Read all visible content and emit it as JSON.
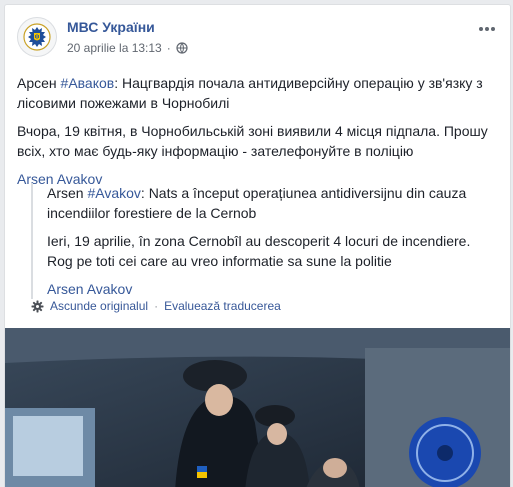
{
  "post": {
    "page_name": "МВС України",
    "timestamp": "20 aprilie la 13:13",
    "more_icon": "ellipsis-icon",
    "privacy_icon": "globe-icon",
    "line1_prefix": "Арсен ",
    "line1_tag": "#Аваков",
    "line1_rest": ": Нацгвардія почала антидиверсійну операцію у зв'язку з лісовими пожежами в Чорнобилі",
    "paragraph2": "Вчора, 19 квітня, в Чорнобильській зоні виявили 4 місця підпала. Прошу всіх, хто має будь-яку інформацію - зателефонуйте в поліцію",
    "author": "Arsen Avakov"
  },
  "translation": {
    "line1_prefix": "Arsen ",
    "line1_tag": "#Avakov",
    "line1_rest": ": Nats a început operațiunea antidiversijnu din cauza incendiilor forestiere de la Cernob",
    "paragraph2": "Ieri, 19 aprilie, în zona Cernobîl au descoperit 4 locuri de incendiere. Rog pe toti cei care au vreo informatie sa sune la politie",
    "author": "Arsen Avakov",
    "hide_original": "Ascunde originalul",
    "separator": "·",
    "rate_translation": "Evaluează traducerea",
    "settings_icon": "gear-icon"
  },
  "colors": {
    "link": "#365899",
    "text": "#1d2129",
    "muted": "#616770",
    "background": "#e9ebee"
  }
}
